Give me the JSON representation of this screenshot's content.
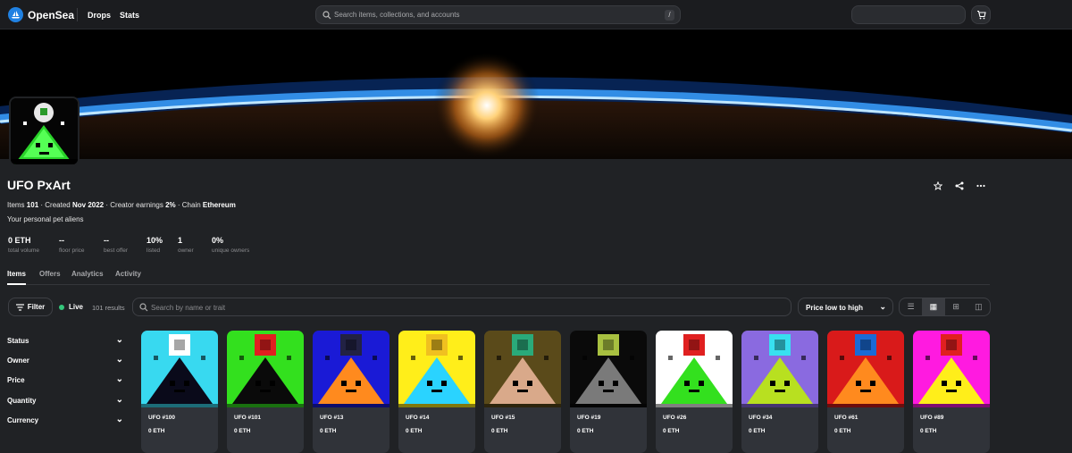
{
  "topbar": {
    "brand": "OpenSea",
    "nav": [
      "Drops",
      "Stats"
    ],
    "search_placeholder": "Search items, collections, and accounts",
    "search_shortcut": "/"
  },
  "collection": {
    "title": "UFO PxArt",
    "meta": {
      "items_label": "Items",
      "items": "101",
      "created_label": "Created",
      "created": "Nov 2022",
      "earnings_label": "Creator earnings",
      "earnings": "2%",
      "chain_label": "Chain",
      "chain": "Ethereum"
    },
    "description": "Your personal pet aliens"
  },
  "stats": [
    {
      "value": "0 ETH",
      "label": "total volume"
    },
    {
      "value": "--",
      "label": "floor price"
    },
    {
      "value": "--",
      "label": "best offer"
    },
    {
      "value": "10%",
      "label": "listed"
    },
    {
      "value": "1",
      "label": "owner"
    },
    {
      "value": "0%",
      "label": "unique owners"
    }
  ],
  "tabs": [
    "Items",
    "Offers",
    "Analytics",
    "Activity"
  ],
  "toolbar": {
    "filter_label": "Filter",
    "live_label": "Live",
    "results": "101 results",
    "search_placeholder": "Search by name or trait",
    "sort_label": "Price low to high"
  },
  "facets": [
    "Status",
    "Owner",
    "Price",
    "Quantity",
    "Currency"
  ],
  "colors": {
    "accent": "#2081e2",
    "live": "#34c77b"
  },
  "items": [
    {
      "name": "UFO #100",
      "price": "0 ETH",
      "bg": "#38d9f0",
      "body": "#0a0a1a",
      "ufo": "#ffffff"
    },
    {
      "name": "UFO #101",
      "price": "0 ETH",
      "bg": "#33e01e",
      "body": "#0a0a0a",
      "ufo": "#e02020"
    },
    {
      "name": "UFO #13",
      "price": "0 ETH",
      "bg": "#1a1ad6",
      "body": "#ff8a1e",
      "ufo": "#222244"
    },
    {
      "name": "UFO #14",
      "price": "0 ETH",
      "bg": "#ffee1a",
      "body": "#2ad3ff",
      "ufo": "#f0c020"
    },
    {
      "name": "UFO #15",
      "price": "0 ETH",
      "bg": "#5a4a1a",
      "body": "#d9a98a",
      "ufo": "#2aaa7a"
    },
    {
      "name": "UFO #19",
      "price": "0 ETH",
      "bg": "#0a0a0a",
      "body": "#7a7a7a",
      "ufo": "#a8c040"
    },
    {
      "name": "UFO #26",
      "price": "0 ETH",
      "bg": "#ffffff",
      "body": "#33e01e",
      "ufo": "#e02020"
    },
    {
      "name": "UFO #34",
      "price": "0 ETH",
      "bg": "#8a6ae0",
      "body": "#b8e020",
      "ufo": "#38e0f0"
    },
    {
      "name": "UFO #61",
      "price": "0 ETH",
      "bg": "#d91a1a",
      "body": "#ff8a1e",
      "ufo": "#1a6ad6"
    },
    {
      "name": "UFO #89",
      "price": "0 ETH",
      "bg": "#ff1ae0",
      "body": "#ffee1a",
      "ufo": "#e02020"
    }
  ]
}
